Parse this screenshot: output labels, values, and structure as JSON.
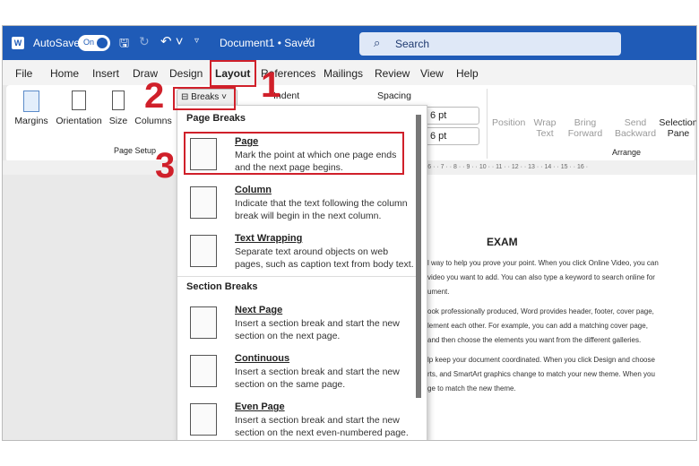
{
  "titlebar": {
    "autosave_label": "AutoSave",
    "autosave_state": "On",
    "doc_title": "Document1 • Saved",
    "search_placeholder": "Search"
  },
  "menu": [
    "File",
    "Home",
    "Insert",
    "Draw",
    "Design",
    "Layout",
    "References",
    "Mailings",
    "Review",
    "View",
    "Help"
  ],
  "ribbon": {
    "margins": "Margins",
    "orientation": "Orientation",
    "size": "Size",
    "columns": "Columns",
    "breaks": "Breaks",
    "indent": "Indent",
    "spacing": "Spacing",
    "spacing_before": "6 pt",
    "spacing_after": "6 pt",
    "page_setup": "Page Setup",
    "position": "Position",
    "wrap_text": "Wrap Text",
    "bring_forward": "Bring Forward",
    "send_backward": "Send Backward",
    "selection_pane": "Selection Pane",
    "arrange": "Arrange"
  },
  "ruler": "· 6 · · 7 · · 8 · · 9 · · 10 · · 11 · · 12 · · 13 · · 14 · · 15 · · 16 ·",
  "dropdown": {
    "page_breaks_header": "Page Breaks",
    "section_breaks_header": "Section Breaks",
    "items": [
      {
        "title": "Page",
        "desc": "Mark the point at which one page ends and the next page begins."
      },
      {
        "title": "Column",
        "desc": "Indicate that the text following the column break will begin in the next column."
      },
      {
        "title": "Text Wrapping",
        "desc": "Separate text around objects on web pages, such as caption text from body text."
      },
      {
        "title": "Next Page",
        "desc": "Insert a section break and start the new section on the next page."
      },
      {
        "title": "Continuous",
        "desc": "Insert a section break and start the new section on the same page."
      },
      {
        "title": "Even Page",
        "desc": "Insert a section break and start the new section on the next even-numbered page."
      }
    ]
  },
  "document": {
    "heading": "EXAM",
    "lines": [
      "l way to help you prove your point. When you click Online Video, you can",
      " video you want to add. You can also type a keyword to search online for",
      "ument.",
      "ook professionally produced, Word provides header, footer, cover page,",
      "lement each other. For example, you can add a matching cover page,",
      "and then choose the elements you want from the different galleries.",
      "lp keep your document coordinated. When you click Design and choose",
      "rts, and SmartArt graphics change to match your new theme. When you",
      "ge to match the new theme."
    ]
  },
  "annotations": {
    "step1": "1",
    "step2": "2",
    "step3": "3"
  },
  "colors": {
    "titlebar": "#1f5bb7",
    "annotation": "#d0202a"
  }
}
